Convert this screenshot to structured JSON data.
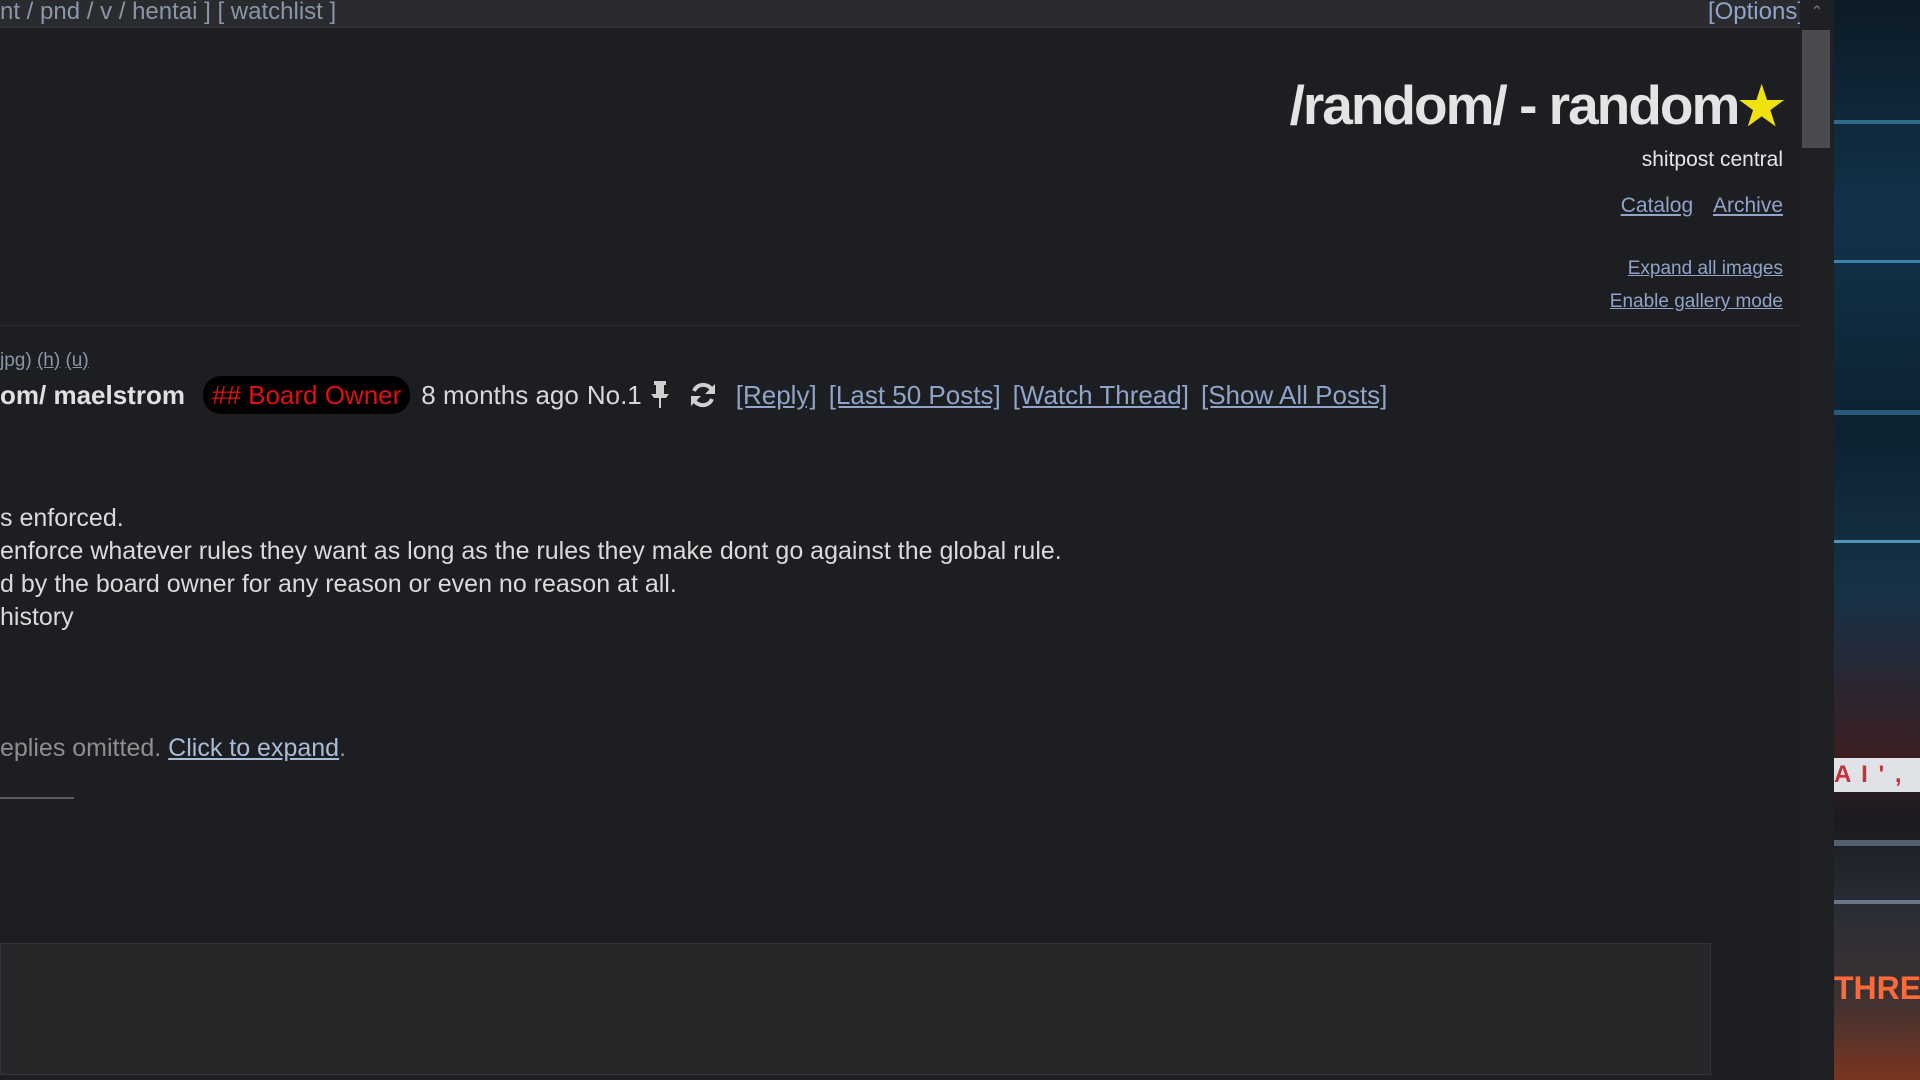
{
  "topbar": {
    "boards_text": "nt / pnd / v / hentai ] [ watchlist ]",
    "options_label": "[Options]"
  },
  "header": {
    "title": "/random/ - random",
    "subtitle": "shitpost central",
    "links": {
      "catalog": "Catalog",
      "archive": "Archive"
    },
    "tools": {
      "expand_images": "Expand all images",
      "gallery_mode": "Enable gallery mode"
    }
  },
  "post": {
    "file_info_prefix": "jpg)",
    "file_info_h": "(h)",
    "file_info_u": "(u)",
    "name": "om/ maelstrom",
    "capcode": "## Board Owner",
    "time": "8 months ago",
    "number": "No.1",
    "actions": {
      "reply": "[Reply]",
      "last50": "[Last 50 Posts]",
      "watch": "[Watch Thread]",
      "show_all": "[Show All Posts]"
    },
    "body": [
      "s enforced.",
      "enforce whatever rules they want as long as the rules they make dont go against the global rule.",
      "d by the board owner for any reason or even no reason at all.",
      "history"
    ],
    "omitted_text": "eplies omitted.",
    "expand_label": "Click to expand"
  },
  "backdrop": {
    "sign_text": "A I ' ,",
    "word_text": "THRE"
  },
  "colors": {
    "background": "#1d1e21",
    "link": "#8fa4c8",
    "capcode_red": "#e01010",
    "star_yellow": "#f0e20e"
  },
  "icons": [
    "chevron-up-icon",
    "star-icon",
    "pin-icon",
    "refresh-icon"
  ]
}
